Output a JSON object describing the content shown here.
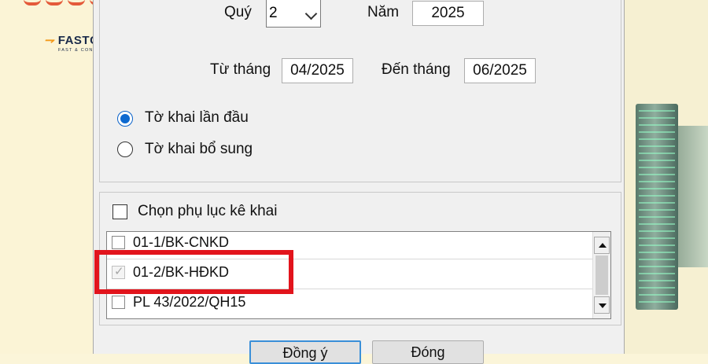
{
  "logo": {
    "brand": "FASTCA",
    "tagline": "FAST & CONVENIENT"
  },
  "period": {
    "quarter_label": "Quý",
    "quarter_value": "2",
    "year_label": "Năm",
    "year_value": "2025",
    "from_label": "Từ tháng",
    "from_value": "04/2025",
    "to_label": "Đến tháng",
    "to_value": "06/2025"
  },
  "declaration_type": {
    "options": [
      {
        "label": "Tờ khai lần đầu",
        "selected": true
      },
      {
        "label": "Tờ khai bổ sung",
        "selected": false
      }
    ]
  },
  "appendix": {
    "select_label": "Chọn phụ lục kê khai",
    "items": [
      {
        "label": "01-1/BK-CNKD",
        "checked": false
      },
      {
        "label": "01-2/BK-HĐKD",
        "checked": true
      },
      {
        "label": "PL 43/2022/QH15",
        "checked": false
      }
    ]
  },
  "buttons": {
    "accept_label": "Đồng ý",
    "close_label": "Đóng"
  },
  "colors": {
    "highlight": "#e2141c",
    "radio_selected": "#0d69d0",
    "brand_accent": "#f39a1b"
  }
}
